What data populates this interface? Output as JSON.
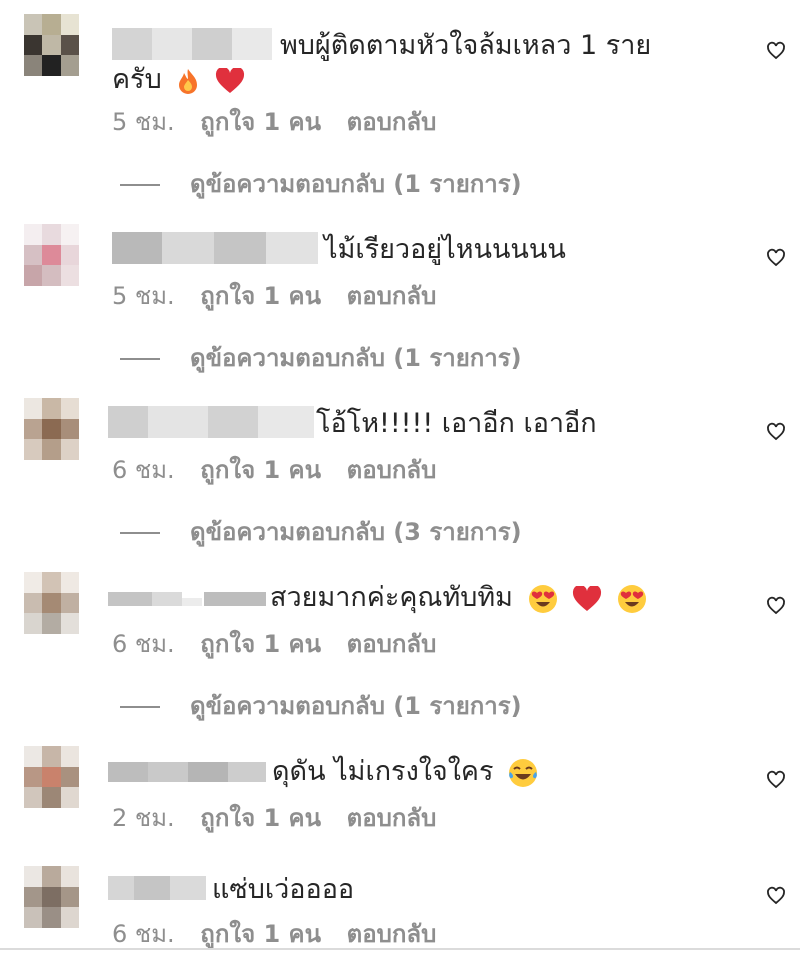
{
  "comments": [
    {
      "text": "พบผู้ติดตามหัวใจล้มเหลว 1 ราย",
      "text2": "ครับ",
      "emojis": [
        "fire-emoji",
        "red-heart-emoji"
      ],
      "time": "5 ชม.",
      "likes": "ถูกใจ 1 คน",
      "reply": "ตอบกลับ",
      "view_replies": "ดูข้อความตอบกลับ (1 รายการ)"
    },
    {
      "text": "ไม้เรียวอยู่ไหนนนนน",
      "time": "5 ชม.",
      "likes": "ถูกใจ 1 คน",
      "reply": "ตอบกลับ",
      "view_replies": "ดูข้อความตอบกลับ (1 รายการ)"
    },
    {
      "text": "โอ้โห!!!!! เอาอีก เอาอีก",
      "time": "6 ชม.",
      "likes": "ถูกใจ 1 คน",
      "reply": "ตอบกลับ",
      "view_replies": "ดูข้อความตอบกลับ (3 รายการ)"
    },
    {
      "text": "สวยมากค่ะคุณทับทิม",
      "emojis": [
        "heart-eyes-emoji",
        "red-heart-emoji",
        "heart-eyes-emoji"
      ],
      "time": "6 ชม.",
      "likes": "ถูกใจ 1 คน",
      "reply": "ตอบกลับ",
      "view_replies": "ดูข้อความตอบกลับ (1 รายการ)"
    },
    {
      "text": "ดุดัน ไม่เกรงใจใคร",
      "emojis": [
        "tears-of-joy-emoji"
      ],
      "time": "2 ชม.",
      "likes": "ถูกใจ 1 คน",
      "reply": "ตอบกลับ"
    },
    {
      "text": "แซ่บเว่ออออ",
      "time": "6 ชม.",
      "likes": "ถูกใจ 1 คน",
      "reply": "ตอบกลับ"
    }
  ],
  "colors": {
    "text": "#262626",
    "meta": "#8e8e8e",
    "heart_red": "#e0303d",
    "divider": "#dbdbdb"
  }
}
